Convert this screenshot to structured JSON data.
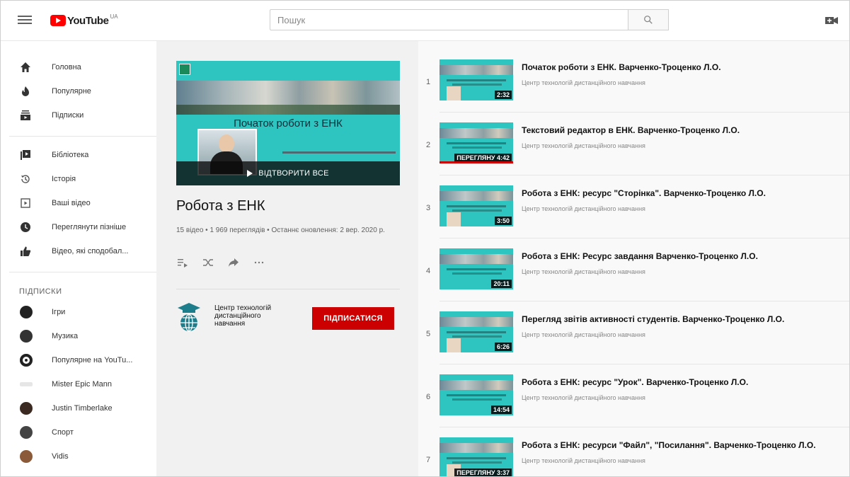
{
  "header": {
    "logo_text": "YouTube",
    "logo_country": "UA",
    "search_placeholder": "Пошук",
    "accent": "#ff0000"
  },
  "sidebar": {
    "main": [
      {
        "label": "Головна",
        "icon": "home-icon"
      },
      {
        "label": "Популярне",
        "icon": "trending-icon"
      },
      {
        "label": "Підписки",
        "icon": "subscriptions-icon"
      }
    ],
    "library": [
      {
        "label": "Бібліотека",
        "icon": "library-icon"
      },
      {
        "label": "Історія",
        "icon": "history-icon"
      },
      {
        "label": "Ваші відео",
        "icon": "your-videos-icon"
      },
      {
        "label": "Переглянути пізніше",
        "icon": "watch-later-icon"
      },
      {
        "label": "Відео, які сподобал...",
        "icon": "liked-icon"
      }
    ],
    "subscriptions_heading": "ПІДПИСКИ",
    "subscriptions": [
      {
        "label": "Ігри",
        "color": "#222222"
      },
      {
        "label": "Музика",
        "color": "#333333"
      },
      {
        "label": "Популярне на YouTu...",
        "color": "#222222"
      },
      {
        "label": "Mister Epic Mann",
        "color": "#d8d8d8"
      },
      {
        "label": "Justin Timberlake",
        "color": "#3a2a22"
      },
      {
        "label": "Спорт",
        "color": "#444444"
      },
      {
        "label": "Vidis",
        "color": "#8a5a3a"
      }
    ]
  },
  "playlist": {
    "thumb_title": "Початок роботи з ЕНК",
    "play_all": "ВІДТВОРИТИ ВСЕ",
    "title": "Робота з ЕНК",
    "stats": "15 відео • 1 969 переглядів • Останнє оновлення: 2 вер. 2020 р.",
    "owner": "Центр технологій дистанційного навчання",
    "subscribe_label": "ПІДПИСАТИСЯ",
    "subscribe_color": "#cc0000"
  },
  "videos": [
    {
      "index": "1",
      "title": "Початок роботи з ЕНК. Варченко-Троценко Л.О.",
      "channel": "Центр технологій дистанційного навчання",
      "duration": "2:32",
      "watched": false
    },
    {
      "index": "2",
      "title": "Текстовий редактор в ЕНК. Варченко-Троценко Л.О.",
      "channel": "Центр технологій дистанційного навчання",
      "duration": "ПЕРЕГЛЯНУ 4:42",
      "watched": true
    },
    {
      "index": "3",
      "title": "Робота з ЕНК: ресурс \"Сторінка\". Варченко-Троценко Л.О.",
      "channel": "Центр технологій дистанційного навчання",
      "duration": "3:50",
      "watched": false
    },
    {
      "index": "4",
      "title": "Робота з ЕНК: Ресурс завдання Варченко-Троценко Л.О.",
      "channel": "Центр технологій дистанційного навчання",
      "duration": "20:11",
      "watched": false
    },
    {
      "index": "5",
      "title": "Перегляд звітів активності студентів. Варченко-Троценко Л.О.",
      "channel": "Центр технологій дистанційного навчання",
      "duration": "6:26",
      "watched": false
    },
    {
      "index": "6",
      "title": "Робота з ЕНК: ресурс \"Урок\". Варченко-Троценко Л.О.",
      "channel": "Центр технологій дистанційного навчання",
      "duration": "14:54",
      "watched": false
    },
    {
      "index": "7",
      "title": "Робота з ЕНК: ресурси \"Файл\", \"Посилання\". Варченко-Троценко Л.О.",
      "channel": "Центр технологій дистанційного навчання",
      "duration": "ПЕРЕГЛЯНУ 3:37",
      "watched": true
    }
  ]
}
